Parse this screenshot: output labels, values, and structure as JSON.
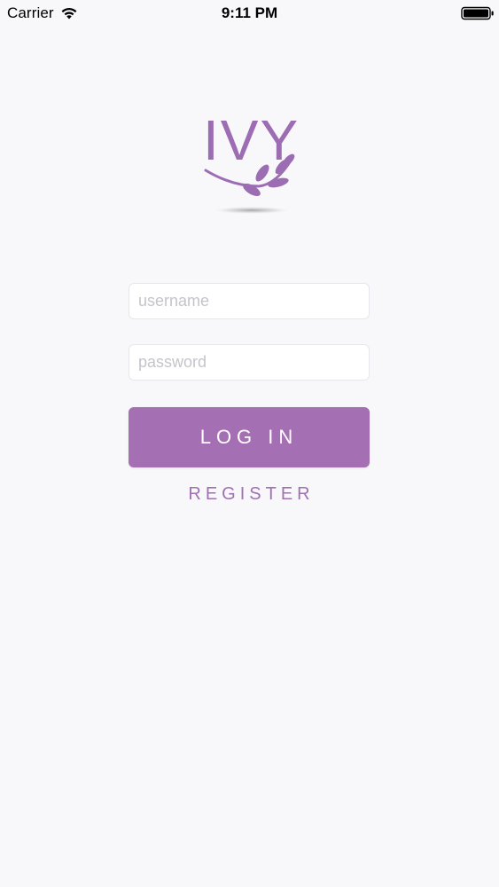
{
  "status_bar": {
    "carrier": "Carrier",
    "time": "9:11 PM",
    "wifi_icon": "wifi-icon",
    "battery_icon": "battery-icon"
  },
  "logo": {
    "text": "IVY",
    "icon": "leaf-branch-icon"
  },
  "form": {
    "username_placeholder": "username",
    "username_value": "",
    "password_placeholder": "password",
    "password_value": "",
    "login_label": "LOG IN",
    "register_label": "REGISTER"
  },
  "colors": {
    "background": "#f8f8fb",
    "accent": "#a56fb3",
    "brand": "#9d6db4"
  }
}
